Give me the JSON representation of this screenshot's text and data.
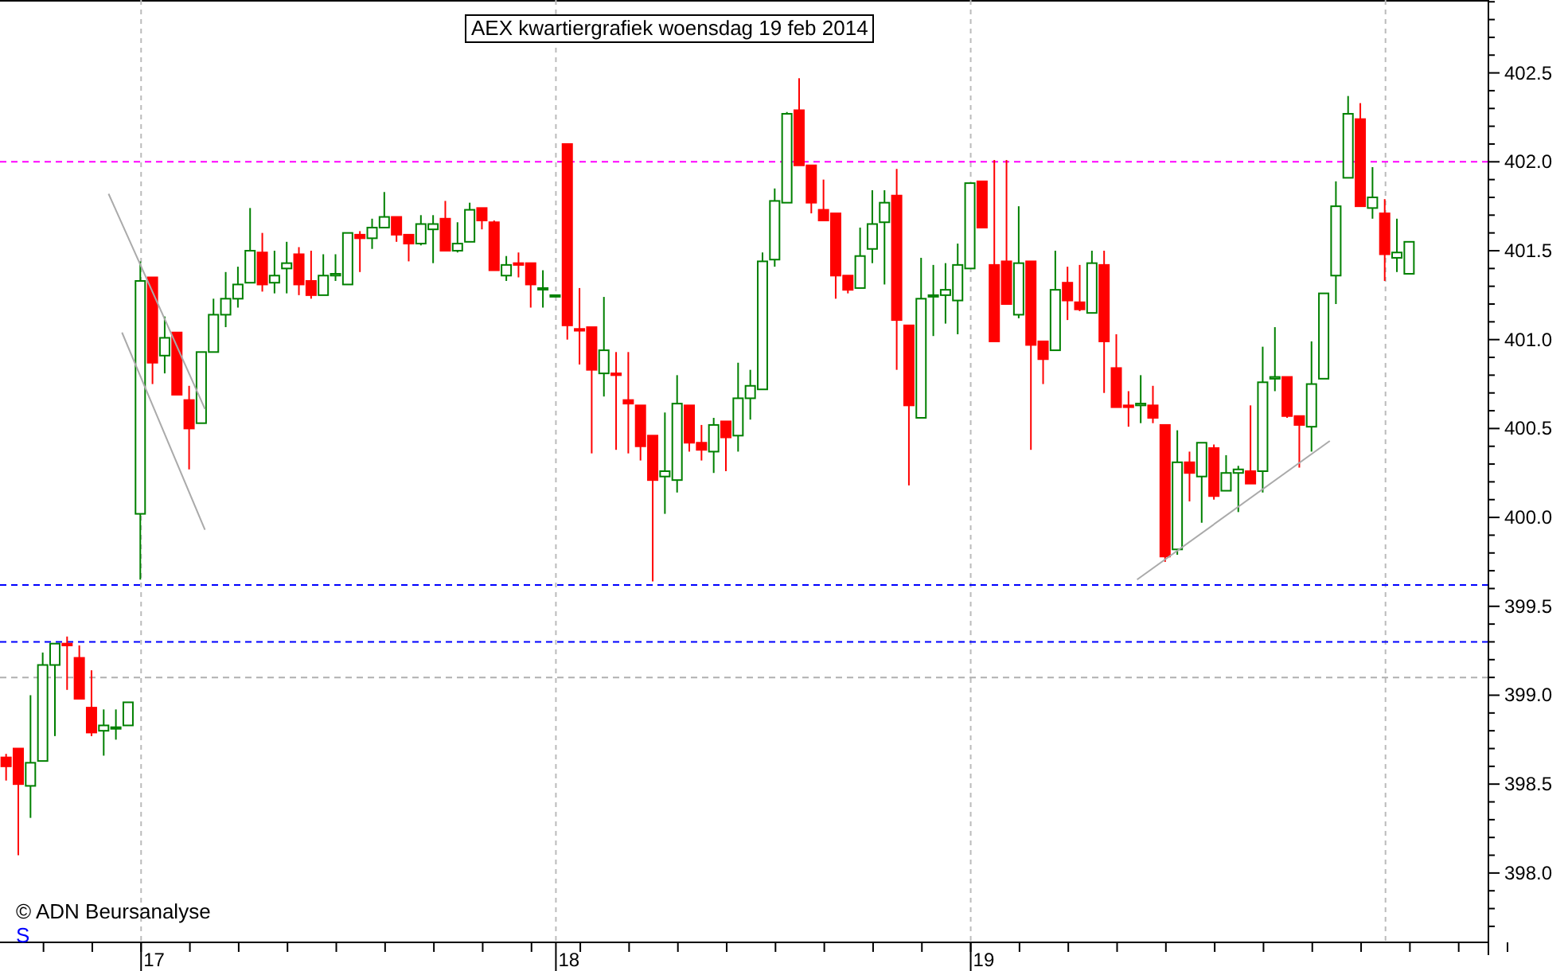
{
  "chart_data": {
    "type": "candlestick",
    "title": "AEX kwartiergrafiek woensdag 19 feb 2014",
    "ylim": [
      397.61,
      402.91
    ],
    "yticks": [
      {
        "value": 398.0,
        "label": "398.0"
      },
      {
        "value": 398.5,
        "label": "398.5"
      },
      {
        "value": 399.0,
        "label": "399.0"
      },
      {
        "value": 399.5,
        "label": "399.5"
      },
      {
        "value": 400.0,
        "label": "400.0"
      },
      {
        "value": 400.5,
        "label": "400.5"
      },
      {
        "value": 401.0,
        "label": "401.0"
      },
      {
        "value": 401.5,
        "label": "401.5"
      },
      {
        "value": 402.0,
        "label": "402.0"
      },
      {
        "value": 402.5,
        "label": "402.5"
      }
    ],
    "categories": [
      null,
      null,
      null,
      null,
      null,
      null,
      null,
      null,
      null,
      null,
      null,
      null,
      "17",
      null,
      null,
      null,
      null,
      null,
      null,
      null,
      null,
      null,
      null,
      null,
      null,
      null,
      null,
      null,
      null,
      null,
      null,
      null,
      null,
      null,
      null,
      null,
      null,
      null,
      null,
      null,
      null,
      null,
      null,
      null,
      null,
      null,
      "18",
      null,
      null,
      null,
      null,
      null,
      null,
      null,
      null,
      null,
      null,
      null,
      null,
      null,
      null,
      null,
      null,
      null,
      null,
      null,
      null,
      null,
      null,
      null,
      null,
      null,
      null,
      null,
      null,
      null,
      null,
      null,
      null,
      null,
      "19",
      null,
      null,
      null,
      null,
      null,
      null,
      null,
      null,
      null,
      null,
      null,
      null,
      null,
      null,
      null,
      null,
      null,
      null,
      null,
      null,
      null,
      null,
      null,
      null,
      null,
      null,
      null,
      null,
      null,
      null,
      null,
      null,
      null,
      null,
      null,
      null,
      null,
      null,
      null,
      null,
      null
    ],
    "ohlc": [
      [
        398.65,
        398.67,
        398.52,
        398.6
      ],
      [
        398.7,
        398.7,
        398.1,
        398.5
      ],
      [
        398.49,
        399.0,
        398.31,
        398.62
      ],
      [
        398.63,
        399.24,
        398.63,
        399.17
      ],
      [
        399.17,
        399.29,
        398.77,
        399.29
      ],
      [
        399.29,
        399.33,
        399.03,
        399.28
      ],
      [
        399.21,
        399.28,
        398.98,
        398.98
      ],
      [
        398.93,
        399.14,
        398.77,
        398.79
      ],
      [
        398.8,
        398.92,
        398.66,
        398.83
      ],
      [
        398.82,
        398.92,
        398.75,
        398.82
      ],
      [
        398.83,
        398.96,
        398.83,
        398.96
      ],
      [
        400.02,
        401.44,
        399.65,
        401.33
      ],
      [
        401.35,
        401.35,
        400.75,
        400.87
      ],
      [
        400.91,
        401.13,
        400.81,
        401.01
      ],
      [
        401.04,
        401.04,
        400.69,
        400.69
      ],
      [
        400.66,
        400.74,
        400.27,
        400.5
      ],
      [
        400.53,
        400.93,
        400.53,
        400.93
      ],
      [
        400.93,
        401.23,
        400.93,
        401.14
      ],
      [
        401.14,
        401.38,
        401.07,
        401.23
      ],
      [
        401.23,
        401.41,
        401.18,
        401.31
      ],
      [
        401.32,
        401.74,
        401.32,
        401.5
      ],
      [
        401.49,
        401.6,
        401.27,
        401.31
      ],
      [
        401.32,
        401.5,
        401.26,
        401.36
      ],
      [
        401.4,
        401.55,
        401.26,
        401.43
      ],
      [
        401.48,
        401.52,
        401.25,
        401.31
      ],
      [
        401.33,
        401.5,
        401.23,
        401.25
      ],
      [
        401.25,
        401.48,
        401.25,
        401.36
      ],
      [
        401.36,
        401.48,
        401.33,
        401.37
      ],
      [
        401.31,
        401.6,
        401.31,
        401.6
      ],
      [
        401.59,
        401.61,
        401.38,
        401.57
      ],
      [
        401.57,
        401.68,
        401.51,
        401.63
      ],
      [
        401.63,
        401.83,
        401.63,
        401.69
      ],
      [
        401.69,
        401.69,
        401.55,
        401.59
      ],
      [
        401.59,
        401.59,
        401.44,
        401.54
      ],
      [
        401.54,
        401.7,
        401.53,
        401.65
      ],
      [
        401.62,
        401.7,
        401.43,
        401.65
      ],
      [
        401.68,
        401.78,
        401.5,
        401.5
      ],
      [
        401.5,
        401.66,
        401.49,
        401.54
      ],
      [
        401.55,
        401.77,
        401.55,
        401.73
      ],
      [
        401.74,
        401.74,
        401.62,
        401.67
      ],
      [
        401.66,
        401.67,
        401.39,
        401.39
      ],
      [
        401.36,
        401.47,
        401.33,
        401.42
      ],
      [
        401.43,
        401.49,
        401.35,
        401.42
      ],
      [
        401.43,
        401.43,
        401.18,
        401.31
      ],
      [
        401.29,
        401.39,
        401.18,
        401.29
      ],
      [
        401.25,
        401.25,
        401.25,
        401.25
      ],
      [
        402.1,
        402.1,
        401.0,
        401.08
      ],
      [
        401.06,
        401.29,
        400.86,
        401.05
      ],
      [
        401.07,
        401.07,
        400.36,
        400.83
      ],
      [
        400.81,
        401.24,
        400.68,
        400.94
      ],
      [
        400.81,
        400.93,
        400.38,
        400.8
      ],
      [
        400.66,
        400.93,
        400.36,
        400.64
      ],
      [
        400.63,
        400.63,
        400.32,
        400.4
      ],
      [
        400.46,
        400.46,
        399.64,
        400.21
      ],
      [
        400.23,
        400.59,
        400.02,
        400.26
      ],
      [
        400.21,
        400.8,
        400.14,
        400.64
      ],
      [
        400.63,
        400.63,
        400.37,
        400.42
      ],
      [
        400.42,
        400.52,
        400.32,
        400.38
      ],
      [
        400.37,
        400.56,
        400.25,
        400.52
      ],
      [
        400.54,
        400.54,
        400.26,
        400.45
      ],
      [
        400.46,
        400.87,
        400.37,
        400.67
      ],
      [
        400.67,
        400.83,
        400.55,
        400.74
      ],
      [
        400.72,
        401.49,
        400.72,
        401.44
      ],
      [
        401.45,
        401.85,
        401.41,
        401.78
      ],
      [
        401.77,
        402.28,
        401.77,
        402.27
      ],
      [
        402.29,
        402.47,
        401.98,
        401.98
      ],
      [
        401.98,
        401.98,
        401.71,
        401.77
      ],
      [
        401.73,
        401.9,
        401.67,
        401.67
      ],
      [
        401.71,
        401.71,
        401.23,
        401.36
      ],
      [
        401.36,
        401.36,
        401.26,
        401.28
      ],
      [
        401.29,
        401.63,
        401.29,
        401.47
      ],
      [
        401.51,
        401.84,
        401.43,
        401.65
      ],
      [
        401.66,
        401.84,
        401.31,
        401.77
      ],
      [
        401.81,
        401.96,
        400.83,
        401.11
      ],
      [
        401.08,
        401.08,
        400.18,
        400.63
      ],
      [
        400.56,
        401.46,
        400.56,
        401.23
      ],
      [
        401.25,
        401.42,
        401.02,
        401.25
      ],
      [
        401.25,
        401.43,
        401.09,
        401.28
      ],
      [
        401.22,
        401.54,
        401.03,
        401.42
      ],
      [
        401.4,
        401.88,
        401.4,
        401.88
      ],
      [
        401.89,
        401.89,
        401.63,
        401.63
      ],
      [
        401.42,
        402.01,
        400.99,
        400.99
      ],
      [
        401.44,
        402.01,
        401.2,
        401.2
      ],
      [
        401.14,
        401.75,
        401.12,
        401.43
      ],
      [
        401.44,
        401.44,
        400.38,
        400.97
      ],
      [
        400.99,
        400.99,
        400.75,
        400.89
      ],
      [
        400.94,
        401.5,
        400.94,
        401.28
      ],
      [
        401.32,
        401.41,
        401.11,
        401.22
      ],
      [
        401.21,
        401.42,
        401.16,
        401.17
      ],
      [
        401.15,
        401.5,
        401.15,
        401.43
      ],
      [
        401.42,
        401.5,
        400.7,
        400.99
      ],
      [
        400.84,
        401.03,
        400.62,
        400.62
      ],
      [
        400.63,
        400.71,
        400.51,
        400.62
      ],
      [
        400.63,
        400.8,
        400.53,
        400.64
      ],
      [
        400.63,
        400.74,
        400.53,
        400.56
      ],
      [
        400.52,
        400.52,
        399.75,
        399.78
      ],
      [
        399.82,
        400.49,
        399.79,
        400.31
      ],
      [
        400.31,
        400.37,
        400.09,
        400.25
      ],
      [
        400.23,
        400.42,
        399.97,
        400.42
      ],
      [
        400.39,
        400.41,
        400.1,
        400.12
      ],
      [
        400.15,
        400.35,
        400.15,
        400.25
      ],
      [
        400.25,
        400.29,
        400.03,
        400.27
      ],
      [
        400.26,
        400.63,
        400.19,
        400.19
      ],
      [
        400.26,
        400.96,
        400.14,
        400.76
      ],
      [
        400.78,
        401.07,
        400.71,
        400.79
      ],
      [
        400.79,
        400.79,
        400.56,
        400.57
      ],
      [
        400.57,
        400.57,
        400.28,
        400.52
      ],
      [
        400.51,
        400.99,
        400.37,
        400.75
      ],
      [
        400.78,
        401.26,
        400.78,
        401.26
      ],
      [
        401.36,
        401.89,
        401.2,
        401.75
      ],
      [
        401.91,
        402.37,
        401.91,
        402.27
      ],
      [
        402.24,
        402.33,
        401.75,
        401.75
      ],
      [
        401.74,
        401.97,
        401.68,
        401.8
      ],
      [
        401.71,
        401.79,
        401.33,
        401.48
      ],
      [
        401.46,
        401.68,
        401.38,
        401.49
      ],
      [
        401.37,
        401.55,
        401.37,
        401.55
      ],
      null,
      null,
      null,
      null,
      null,
      null
    ],
    "ref_lines": [
      {
        "axis": "y",
        "value": 402.0,
        "color": "#ff00ff"
      },
      {
        "axis": "y",
        "value": 399.62,
        "color": "#0000ff"
      },
      {
        "axis": "y",
        "value": 399.3,
        "color": "#0000ff"
      },
      {
        "axis": "y",
        "value": 399.1,
        "color": "#b0b0b0"
      }
    ]
  },
  "copyright": "© ADN Beursanalyse",
  "corner_mark": "S"
}
